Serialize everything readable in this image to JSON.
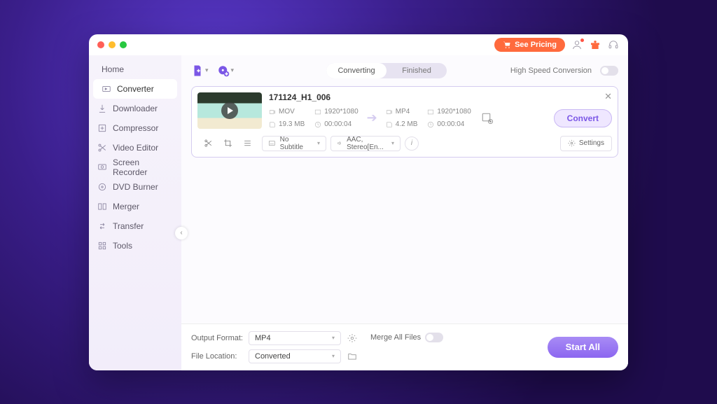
{
  "topbar": {
    "pricing_label": "See Pricing"
  },
  "sidebar": {
    "items": [
      {
        "label": "Home"
      },
      {
        "label": "Converter"
      },
      {
        "label": "Downloader"
      },
      {
        "label": "Compressor"
      },
      {
        "label": "Video Editor"
      },
      {
        "label": "Screen Recorder"
      },
      {
        "label": "DVD Burner"
      },
      {
        "label": "Merger"
      },
      {
        "label": "Transfer"
      },
      {
        "label": "Tools"
      }
    ]
  },
  "toolrow": {
    "segment": {
      "converting": "Converting",
      "finished": "Finished"
    },
    "highspeed_label": "High Speed Conversion"
  },
  "file": {
    "name": "171124_H1_006",
    "source": {
      "format": "MOV",
      "resolution": "1920*1080",
      "size": "19.3 MB",
      "duration": "00:00:04"
    },
    "target": {
      "format": "MP4",
      "resolution": "1920*1080",
      "size": "4.2 MB",
      "duration": "00:00:04"
    },
    "subtitle_label": "No Subtitle",
    "audio_label": "AAC, Stereo[En...",
    "settings_label": "Settings",
    "convert_label": "Convert"
  },
  "footer": {
    "output_format_label": "Output Format:",
    "output_format_value": "MP4",
    "file_location_label": "File Location:",
    "file_location_value": "Converted",
    "merge_label": "Merge All Files",
    "startall_label": "Start All"
  }
}
